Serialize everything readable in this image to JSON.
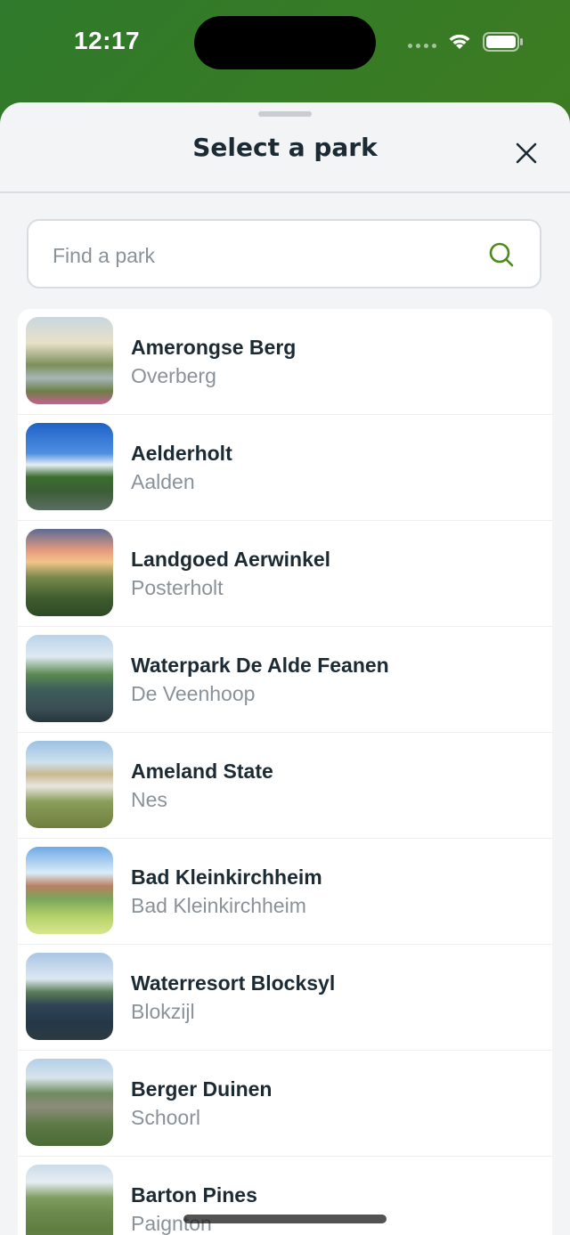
{
  "status_bar": {
    "time": "12:17"
  },
  "sheet": {
    "title": "Select a park",
    "close_icon": "close-icon"
  },
  "search": {
    "placeholder": "Find a park",
    "value": "",
    "icon": "search-icon",
    "accent_color": "#4d8a1c"
  },
  "parks": [
    {
      "name": "Amerongse Berg",
      "location": "Overberg"
    },
    {
      "name": "Aelderholt",
      "location": "Aalden"
    },
    {
      "name": "Landgoed Aerwinkel",
      "location": "Posterholt"
    },
    {
      "name": "Waterpark De Alde Feanen",
      "location": "De Veenhoop"
    },
    {
      "name": "Ameland State",
      "location": "Nes"
    },
    {
      "name": "Bad Kleinkirchheim",
      "location": "Bad Kleinkirchheim"
    },
    {
      "name": "Waterresort Blocksyl",
      "location": "Blokzijl"
    },
    {
      "name": "Berger Duinen",
      "location": "Schoorl"
    },
    {
      "name": "Barton Pines",
      "location": "Paignton"
    }
  ],
  "colors": {
    "header_gradient_start": "#2f7a2c",
    "header_gradient_end": "#5a7d0a",
    "sheet_background": "#f2f4f6",
    "title_text": "#1c2a33",
    "secondary_text": "#8a9298"
  }
}
